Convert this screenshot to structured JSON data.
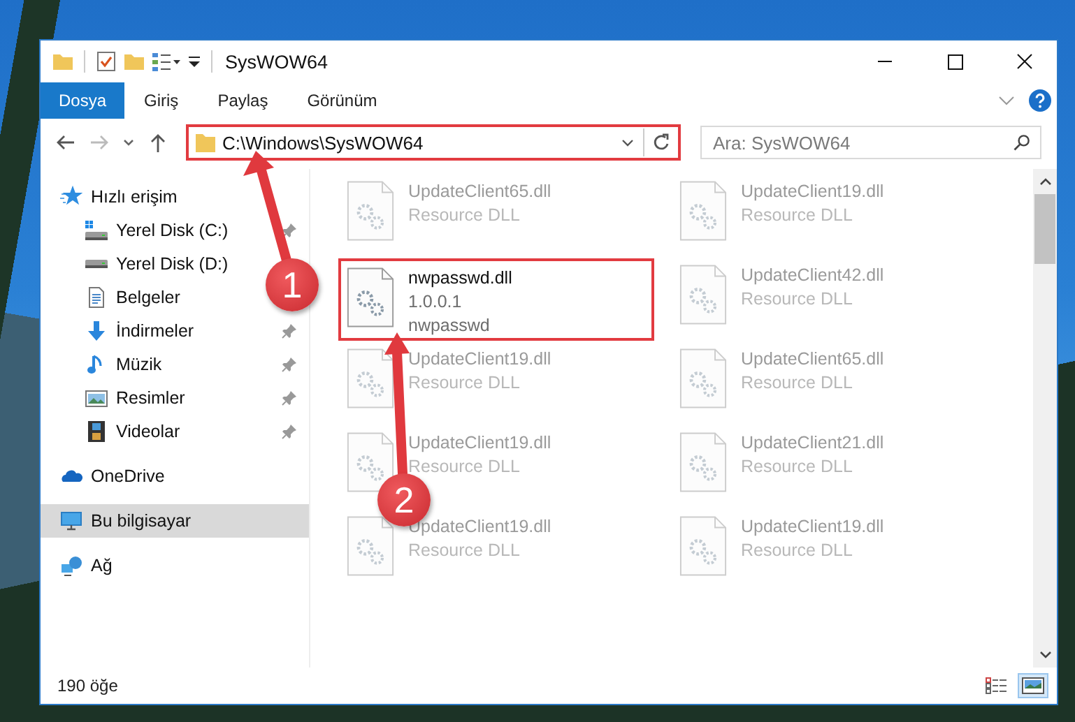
{
  "window": {
    "title": "SysWOW64"
  },
  "ribbon_tabs": [
    {
      "label": "Dosya",
      "kind": "file"
    },
    {
      "label": "Giriş",
      "kind": "tab"
    },
    {
      "label": "Paylaş",
      "kind": "tab"
    },
    {
      "label": "Görünüm",
      "kind": "tab"
    }
  ],
  "address_bar": {
    "path": "C:\\Windows\\SysWOW64",
    "highlighted": true
  },
  "search": {
    "placeholder": "Ara: SysWOW64"
  },
  "sidebar": {
    "items": [
      {
        "label": "Hızlı erişim",
        "kind": "star",
        "selected": false,
        "children": [
          {
            "label": "Yerel Disk (C:)",
            "kind": "windrive",
            "pinned": true
          },
          {
            "label": "Yerel Disk (D:)",
            "kind": "drive",
            "pinned": false
          },
          {
            "label": "Belgeler",
            "kind": "document",
            "pinned": false
          },
          {
            "label": "İndirmeler",
            "kind": "download",
            "pinned": true
          },
          {
            "label": "Müzik",
            "kind": "music",
            "pinned": true
          },
          {
            "label": "Resimler",
            "kind": "pictures",
            "pinned": true
          },
          {
            "label": "Videolar",
            "kind": "video",
            "pinned": true
          }
        ]
      },
      {
        "label": "OneDrive",
        "kind": "cloud",
        "selected": false
      },
      {
        "label": "Bu bilgisayar",
        "kind": "computer",
        "selected": true
      },
      {
        "label": "Ağ",
        "kind": "network",
        "selected": false
      }
    ]
  },
  "files": [
    {
      "name": "UpdateClient65.dll",
      "details": [
        "Resource DLL"
      ],
      "highlighted": false
    },
    {
      "name": "UpdateClient19.dll",
      "details": [
        "Resource DLL"
      ],
      "highlighted": false
    },
    {
      "name": "nwpasswd.dll",
      "details": [
        "1.0.0.1",
        "nwpasswd"
      ],
      "highlighted": true
    },
    {
      "name": "UpdateClient42.dll",
      "details": [
        "Resource DLL"
      ],
      "highlighted": false
    },
    {
      "name": "UpdateClient19.dll",
      "details": [
        "Resource DLL"
      ],
      "highlighted": false
    },
    {
      "name": "UpdateClient65.dll",
      "details": [
        "Resource DLL"
      ],
      "highlighted": false
    },
    {
      "name": "UpdateClient19.dll",
      "details": [
        "Resource DLL"
      ],
      "highlighted": false
    },
    {
      "name": "UpdateClient21.dll",
      "details": [
        "Resource DLL"
      ],
      "highlighted": false
    },
    {
      "name": "UpdateClient19.dll",
      "details": [
        "Resource DLL"
      ],
      "highlighted": false
    },
    {
      "name": "UpdateClient19.dll",
      "details": [
        "Resource DLL"
      ],
      "highlighted": false
    }
  ],
  "status_bar": {
    "item_count": "190 öğe",
    "views": [
      {
        "kind": "details",
        "selected": false
      },
      {
        "kind": "large_icons",
        "selected": true
      }
    ]
  },
  "annotations": [
    {
      "label": "1"
    },
    {
      "label": "2"
    }
  ]
}
